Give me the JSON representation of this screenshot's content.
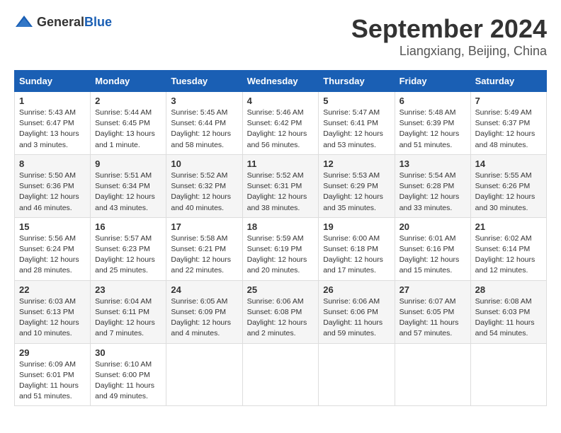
{
  "header": {
    "logo_general": "General",
    "logo_blue": "Blue",
    "month_year": "September 2024",
    "location": "Liangxiang, Beijing, China"
  },
  "days_of_week": [
    "Sunday",
    "Monday",
    "Tuesday",
    "Wednesday",
    "Thursday",
    "Friday",
    "Saturday"
  ],
  "weeks": [
    [
      {
        "day": "1",
        "content": "Sunrise: 5:43 AM\nSunset: 6:47 PM\nDaylight: 13 hours\nand 3 minutes."
      },
      {
        "day": "2",
        "content": "Sunrise: 5:44 AM\nSunset: 6:45 PM\nDaylight: 13 hours\nand 1 minute."
      },
      {
        "day": "3",
        "content": "Sunrise: 5:45 AM\nSunset: 6:44 PM\nDaylight: 12 hours\nand 58 minutes."
      },
      {
        "day": "4",
        "content": "Sunrise: 5:46 AM\nSunset: 6:42 PM\nDaylight: 12 hours\nand 56 minutes."
      },
      {
        "day": "5",
        "content": "Sunrise: 5:47 AM\nSunset: 6:41 PM\nDaylight: 12 hours\nand 53 minutes."
      },
      {
        "day": "6",
        "content": "Sunrise: 5:48 AM\nSunset: 6:39 PM\nDaylight: 12 hours\nand 51 minutes."
      },
      {
        "day": "7",
        "content": "Sunrise: 5:49 AM\nSunset: 6:37 PM\nDaylight: 12 hours\nand 48 minutes."
      }
    ],
    [
      {
        "day": "8",
        "content": "Sunrise: 5:50 AM\nSunset: 6:36 PM\nDaylight: 12 hours\nand 46 minutes."
      },
      {
        "day": "9",
        "content": "Sunrise: 5:51 AM\nSunset: 6:34 PM\nDaylight: 12 hours\nand 43 minutes."
      },
      {
        "day": "10",
        "content": "Sunrise: 5:52 AM\nSunset: 6:32 PM\nDaylight: 12 hours\nand 40 minutes."
      },
      {
        "day": "11",
        "content": "Sunrise: 5:52 AM\nSunset: 6:31 PM\nDaylight: 12 hours\nand 38 minutes."
      },
      {
        "day": "12",
        "content": "Sunrise: 5:53 AM\nSunset: 6:29 PM\nDaylight: 12 hours\nand 35 minutes."
      },
      {
        "day": "13",
        "content": "Sunrise: 5:54 AM\nSunset: 6:28 PM\nDaylight: 12 hours\nand 33 minutes."
      },
      {
        "day": "14",
        "content": "Sunrise: 5:55 AM\nSunset: 6:26 PM\nDaylight: 12 hours\nand 30 minutes."
      }
    ],
    [
      {
        "day": "15",
        "content": "Sunrise: 5:56 AM\nSunset: 6:24 PM\nDaylight: 12 hours\nand 28 minutes."
      },
      {
        "day": "16",
        "content": "Sunrise: 5:57 AM\nSunset: 6:23 PM\nDaylight: 12 hours\nand 25 minutes."
      },
      {
        "day": "17",
        "content": "Sunrise: 5:58 AM\nSunset: 6:21 PM\nDaylight: 12 hours\nand 22 minutes."
      },
      {
        "day": "18",
        "content": "Sunrise: 5:59 AM\nSunset: 6:19 PM\nDaylight: 12 hours\nand 20 minutes."
      },
      {
        "day": "19",
        "content": "Sunrise: 6:00 AM\nSunset: 6:18 PM\nDaylight: 12 hours\nand 17 minutes."
      },
      {
        "day": "20",
        "content": "Sunrise: 6:01 AM\nSunset: 6:16 PM\nDaylight: 12 hours\nand 15 minutes."
      },
      {
        "day": "21",
        "content": "Sunrise: 6:02 AM\nSunset: 6:14 PM\nDaylight: 12 hours\nand 12 minutes."
      }
    ],
    [
      {
        "day": "22",
        "content": "Sunrise: 6:03 AM\nSunset: 6:13 PM\nDaylight: 12 hours\nand 10 minutes."
      },
      {
        "day": "23",
        "content": "Sunrise: 6:04 AM\nSunset: 6:11 PM\nDaylight: 12 hours\nand 7 minutes."
      },
      {
        "day": "24",
        "content": "Sunrise: 6:05 AM\nSunset: 6:09 PM\nDaylight: 12 hours\nand 4 minutes."
      },
      {
        "day": "25",
        "content": "Sunrise: 6:06 AM\nSunset: 6:08 PM\nDaylight: 12 hours\nand 2 minutes."
      },
      {
        "day": "26",
        "content": "Sunrise: 6:06 AM\nSunset: 6:06 PM\nDaylight: 11 hours\nand 59 minutes."
      },
      {
        "day": "27",
        "content": "Sunrise: 6:07 AM\nSunset: 6:05 PM\nDaylight: 11 hours\nand 57 minutes."
      },
      {
        "day": "28",
        "content": "Sunrise: 6:08 AM\nSunset: 6:03 PM\nDaylight: 11 hours\nand 54 minutes."
      }
    ],
    [
      {
        "day": "29",
        "content": "Sunrise: 6:09 AM\nSunset: 6:01 PM\nDaylight: 11 hours\nand 51 minutes."
      },
      {
        "day": "30",
        "content": "Sunrise: 6:10 AM\nSunset: 6:00 PM\nDaylight: 11 hours\nand 49 minutes."
      },
      {
        "day": "",
        "content": ""
      },
      {
        "day": "",
        "content": ""
      },
      {
        "day": "",
        "content": ""
      },
      {
        "day": "",
        "content": ""
      },
      {
        "day": "",
        "content": ""
      }
    ]
  ]
}
